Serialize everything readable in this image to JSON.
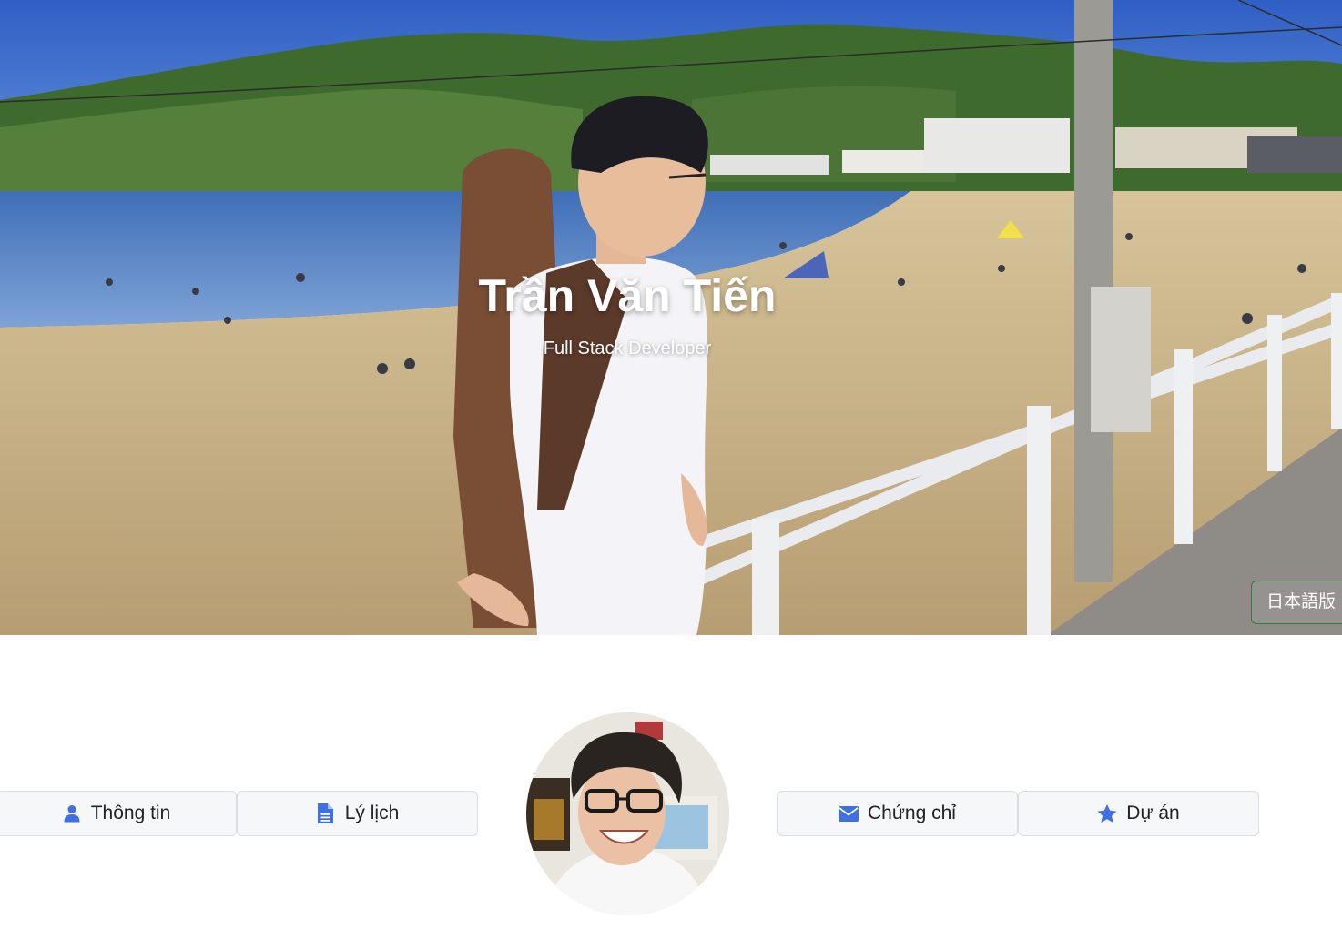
{
  "hero": {
    "name": "Trần Văn Tiến",
    "role": "Full Stack Developer",
    "language_button": "日本語版"
  },
  "nav": {
    "items": [
      {
        "label": "Thông tin",
        "icon": "user-icon"
      },
      {
        "label": "Lý lịch",
        "icon": "document-icon"
      },
      {
        "label": "Chứng chỉ",
        "icon": "envelope-icon"
      },
      {
        "label": "Dự án",
        "icon": "star-icon"
      }
    ]
  },
  "colors": {
    "accent": "#3f6fe0",
    "button_bg": "#f6f7f9",
    "button_border": "#d9dce1",
    "lang_border": "#2e7d3a"
  }
}
